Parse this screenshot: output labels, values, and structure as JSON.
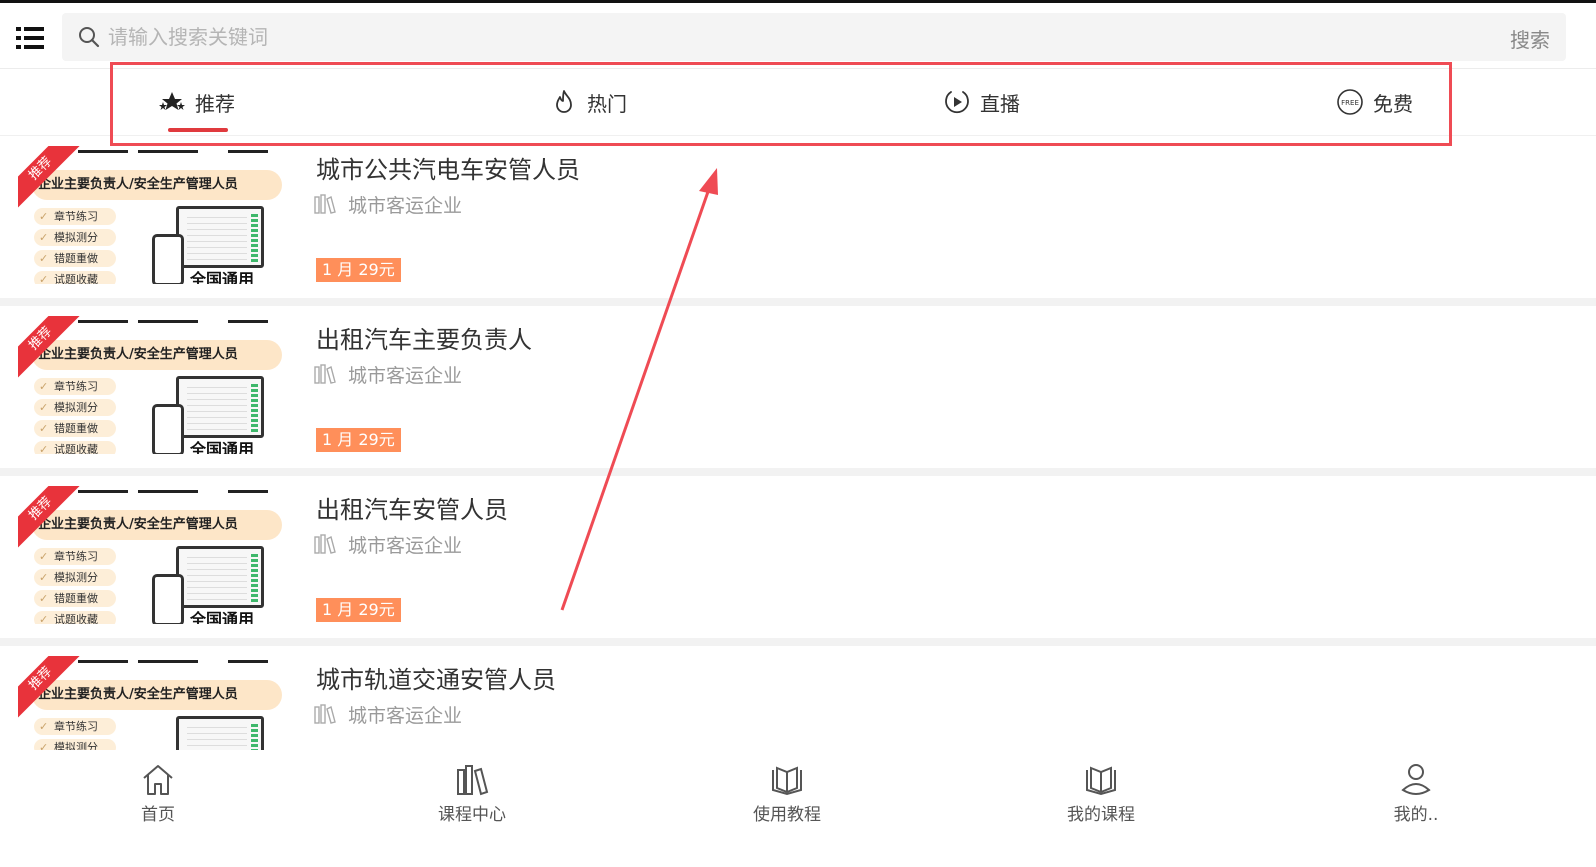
{
  "header": {
    "search_placeholder": "请输入搜索关键词",
    "search_button": "搜索"
  },
  "tabs": [
    {
      "label": "推荐",
      "icon": "stars-icon",
      "active": true
    },
    {
      "label": "热门",
      "icon": "flame-icon",
      "active": false
    },
    {
      "label": "直播",
      "icon": "play-icon",
      "active": false
    },
    {
      "label": "免费",
      "icon": "free-icon",
      "active": false
    }
  ],
  "courses": [
    {
      "title": "城市公共汽电车安管人员",
      "category": "城市客运企业",
      "price": "1 月 29元",
      "thumb": {
        "ribbon": "推荐",
        "banner": "企业主要负责人/安全生产管理人员",
        "features": [
          "章节练习",
          "模拟测分",
          "错题重做",
          "试题收藏"
        ],
        "caption": "全国通用"
      }
    },
    {
      "title": "出租汽车主要负责人",
      "category": "城市客运企业",
      "price": "1 月 29元",
      "thumb": {
        "ribbon": "推荐",
        "banner": "企业主要负责人/安全生产管理人员",
        "features": [
          "章节练习",
          "模拟测分",
          "错题重做",
          "试题收藏"
        ],
        "caption": "全国通用"
      }
    },
    {
      "title": "出租汽车安管人员",
      "category": "城市客运企业",
      "price": "1 月 29元",
      "thumb": {
        "ribbon": "推荐",
        "banner": "企业主要负责人/安全生产管理人员",
        "features": [
          "章节练习",
          "模拟测分",
          "错题重做",
          "试题收藏"
        ],
        "caption": "全国通用"
      }
    },
    {
      "title": "城市轨道交通安管人员",
      "category": "城市客运企业",
      "thumb": {
        "ribbon": "推荐",
        "banner": "企业主要负责人/安全生产管理人员",
        "features": [
          "章节练习",
          "模拟测分"
        ]
      }
    }
  ],
  "bottom_nav": [
    {
      "label": "首页",
      "icon": "home-icon"
    },
    {
      "label": "课程中心",
      "icon": "books-icon"
    },
    {
      "label": "使用教程",
      "icon": "open-book-icon"
    },
    {
      "label": "我的课程",
      "icon": "my-courses-icon"
    },
    {
      "label": "我的..",
      "icon": "user-icon"
    }
  ],
  "colors": {
    "accent": "#e03a3e",
    "annotation": "#ef4b54",
    "price": "#ff8f5a"
  }
}
